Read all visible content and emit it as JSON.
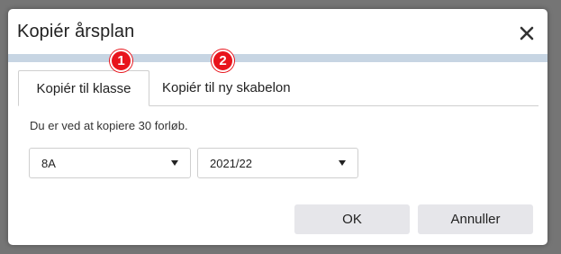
{
  "dialog": {
    "title": "Kopiér årsplan",
    "close_icon": "close-icon"
  },
  "tabs": [
    {
      "label": "Kopiér til klasse",
      "active": true,
      "badge": "1"
    },
    {
      "label": "Kopiér til ny skabelon",
      "active": false,
      "badge": "2"
    }
  ],
  "body": {
    "info_text": "Du er ved at kopiere 30 forløb."
  },
  "selects": {
    "class_value": "8A",
    "year_value": "2021/22"
  },
  "buttons": {
    "ok_label": "OK",
    "cancel_label": "Annuller"
  },
  "colors": {
    "accent_bar": "#c7d5e3",
    "badge": "#e8141c",
    "button_bg": "#e6e6ea",
    "backdrop": "#757575"
  }
}
